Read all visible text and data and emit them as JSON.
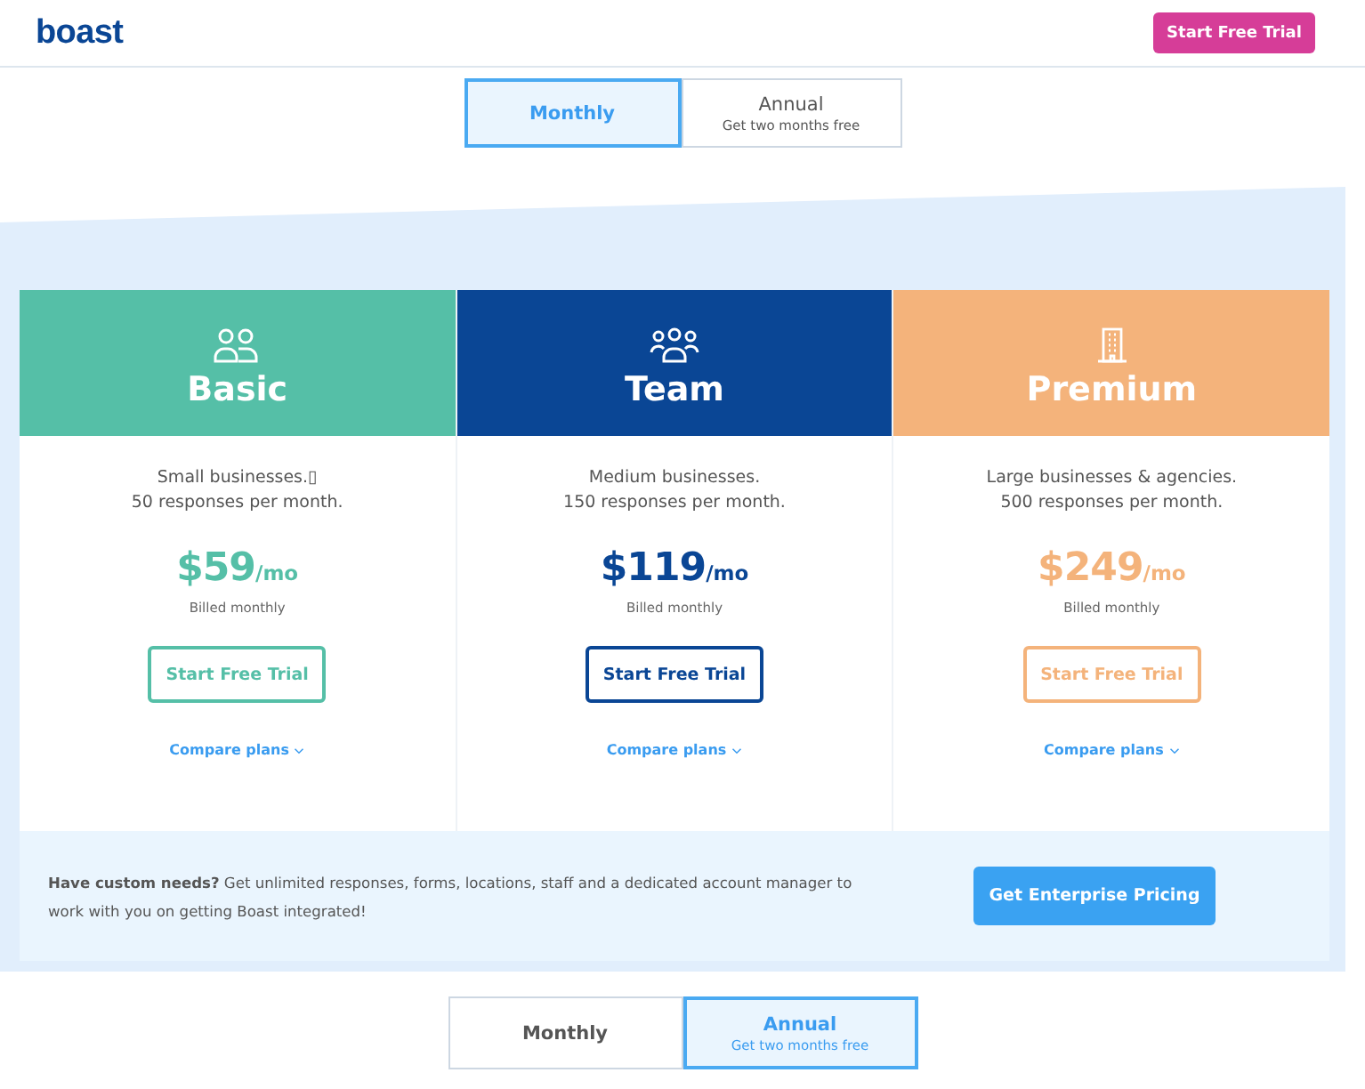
{
  "header": {
    "logo": "boast",
    "cta": "Start Free Trial"
  },
  "billing_toggle_top": [
    {
      "label": "Monthly",
      "selected": true
    },
    {
      "label": "Annual",
      "sublabel": "Get two months free",
      "selected": false
    }
  ],
  "plans": [
    {
      "kind": "pair",
      "name": "Basic",
      "color": "#55bfa7",
      "description": [
        "Small businesses.▯",
        "50 responses per month."
      ],
      "price": "$59",
      "unit": "/mo",
      "billing": "Billed monthly",
      "button": "Start Free Trial",
      "compare": "Compare plans"
    },
    {
      "kind": "group",
      "name": "Team",
      "color": "#0a4695",
      "description": [
        "Medium businesses.",
        "150 responses per month."
      ],
      "price": "$119",
      "unit": "/mo",
      "billing": "Billed monthly",
      "button": "Start Free Trial",
      "compare": "Compare plans"
    },
    {
      "kind": "office",
      "name": "Premium",
      "color": "#f4b37b",
      "description": [
        "Large businesses & agencies.",
        "500 responses per month."
      ],
      "price": "$249",
      "unit": "/mo",
      "billing": "Billed monthly",
      "button": "Start Free Trial",
      "compare": "Compare plans"
    }
  ],
  "enterprise": {
    "text": "**Have custom needs?**  Get unlimited responses, forms, locations, staff and a dedicated account manager to work with you on getting Boast integrated!",
    "button": "Get Enterprise Pricing"
  },
  "billing_toggle_bottom": [
    {
      "label": "Monthly",
      "selected": false
    },
    {
      "label": "Annual",
      "sublabel": "Get two months free",
      "selected": true
    }
  ]
}
